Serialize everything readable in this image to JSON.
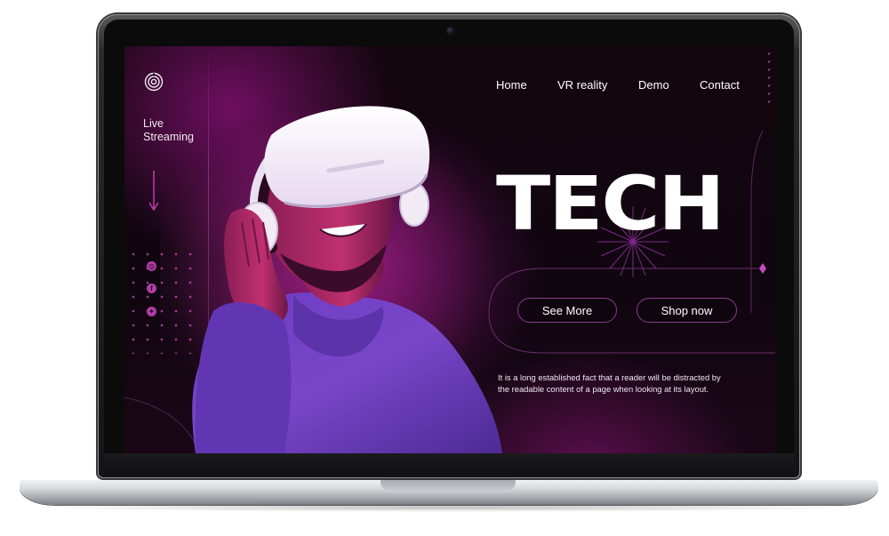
{
  "sidebar": {
    "logo_icon": "spiral-logo-icon",
    "live_line1": "Live",
    "live_line2": "Streaming",
    "arrow_icon": "arrow-down-icon",
    "social_icons": [
      "instagram-icon",
      "facebook-icon",
      "twitter-icon"
    ]
  },
  "nav": {
    "items": [
      "Home",
      "VR reality",
      "Demo",
      "Contact"
    ]
  },
  "hero": {
    "title": "TECH",
    "see_more": "See More",
    "shop_now": "Shop now",
    "body_line1": "It is a long established fact that a reader will be distracted by",
    "body_line2": "the readable content of a page when looking at its layout."
  },
  "theme": {
    "background": "#120610",
    "accent": "#a62c9f",
    "button_border": "#8b3a93",
    "text": "#ffffff"
  }
}
